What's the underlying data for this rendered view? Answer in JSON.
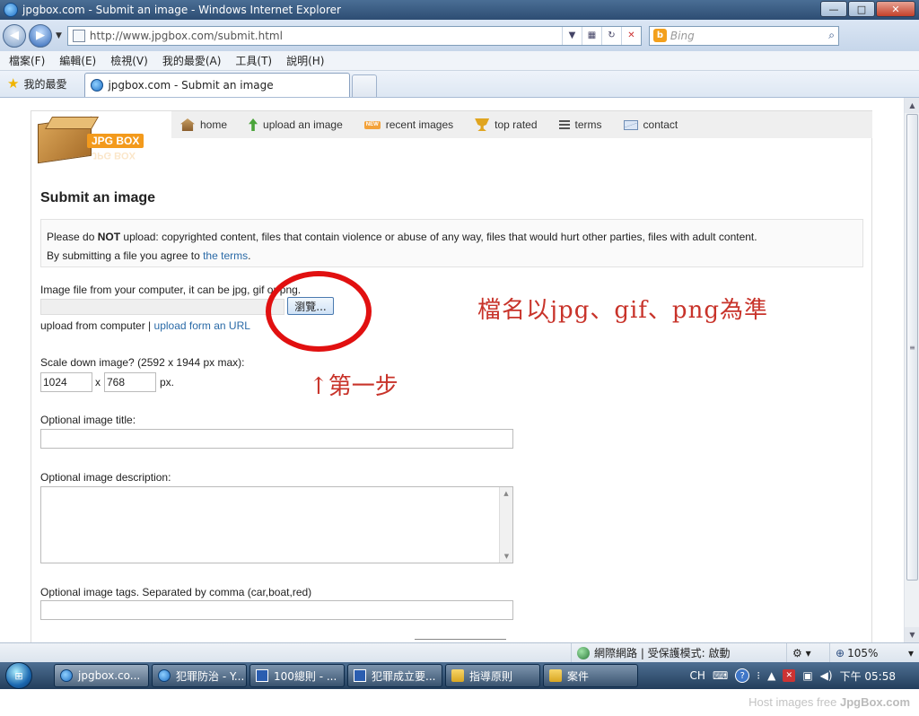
{
  "window": {
    "title": "jpgbox.com - Submit an image - Windows Internet Explorer",
    "minimize": "—",
    "maximize": "□",
    "close": "✕"
  },
  "addressbar": {
    "url": "http://www.jpgbox.com/submit.html",
    "search_placeholder": "Bing",
    "bing_icon": "b",
    "search_go": "⌕"
  },
  "menu": [
    "檔案(F)",
    "編輯(E)",
    "檢視(V)",
    "我的最愛(A)",
    "工具(T)",
    "說明(H)"
  ],
  "favorites": {
    "label": "我的最愛",
    "tab_title": "jpgbox.com - Submit an image"
  },
  "site": {
    "logo_text": "JPG BOX",
    "nav": [
      {
        "label": "home",
        "icon": "house-icon"
      },
      {
        "label": "upload an image",
        "icon": "upload-arrow-icon"
      },
      {
        "label": "recent images",
        "icon": "new-badge-icon"
      },
      {
        "label": "top rated",
        "icon": "trophy-icon"
      },
      {
        "label": "terms",
        "icon": "document-lines-icon"
      },
      {
        "label": "contact",
        "icon": "mail-icon"
      }
    ],
    "new_badge": "NEW"
  },
  "form": {
    "heading": "Submit an image",
    "notice_prefix": "Please do ",
    "notice_not": "NOT",
    "notice_rest": " upload: copyrighted content, files that contain violence or abuse of any way, files that would hurt other parties, files with adult content.",
    "agree_prefix": "By submitting a file you agree to ",
    "agree_link": "the terms",
    "agree_suffix": ".",
    "file_label": "Image file from your computer, it can be jpg, gif or png.",
    "browse_label": "瀏覽...",
    "upload_mode_text": "upload from computer | ",
    "upload_url_link": "upload form an URL",
    "scale_label": "Scale down image? (2592 x 1944 px max):",
    "width_value": "1024",
    "height_value": "768",
    "x_sep": "x",
    "px_suffix": "px.",
    "title_label": "Optional image title:",
    "title_value": "",
    "desc_label": "Optional image description:",
    "tags_label": "Optional image tags. Separated by comma (car,boat,red)",
    "tags_value": ""
  },
  "annotations": {
    "filetype_note": "檔名以jpg、gif、png為準",
    "step_note": "↑第一步",
    "highlight_color": "#e11010",
    "text_color": "#c8332a"
  },
  "statusbar": {
    "zone": "網際網路 | 受保護模式: 啟動",
    "zoom": "105%"
  },
  "taskbar": {
    "items": [
      {
        "label": "jpgbox.co...",
        "icon": "ie"
      },
      {
        "label": "犯罪防治 - Y...",
        "icon": "ie"
      },
      {
        "label": "100總則 - ...",
        "icon": "word"
      },
      {
        "label": "犯罪成立要...",
        "icon": "word"
      },
      {
        "label": "指導原則",
        "icon": "folder"
      },
      {
        "label": "案件",
        "icon": "folder"
      }
    ],
    "ime": "CH",
    "clock": "下午 05:58"
  },
  "footer": {
    "prefix": "Host images free ",
    "brand": "JpgBox.com"
  }
}
